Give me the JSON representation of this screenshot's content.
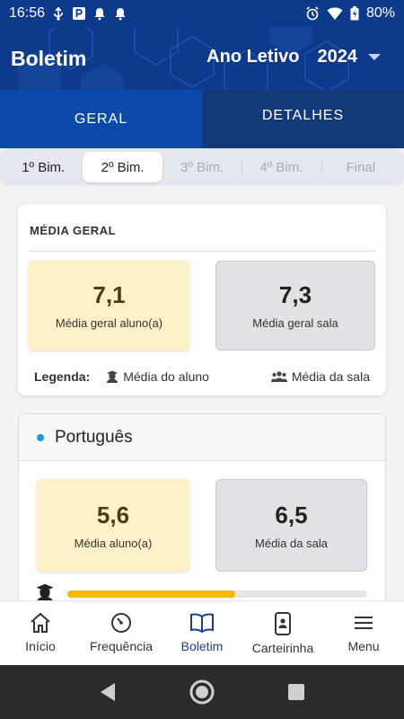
{
  "status_bar": {
    "time": "16:56",
    "battery": "80%"
  },
  "header": {
    "title": "Boletim",
    "year_label": "Ano Letivo",
    "year_value": "2024"
  },
  "tabs": [
    {
      "label": "GERAL",
      "active": true
    },
    {
      "label": "DETALHES",
      "active": false
    }
  ],
  "bimesters": [
    {
      "label": "1º Bim.",
      "state": "enabled"
    },
    {
      "label": "2º Bim.",
      "state": "selected"
    },
    {
      "label": "3º Bim.",
      "state": "disabled"
    },
    {
      "label": "4º Bim.",
      "state": "disabled"
    },
    {
      "label": "Final",
      "state": "disabled"
    }
  ],
  "overall": {
    "title": "MÉDIA GERAL",
    "student_value": "7,1",
    "student_label": "Média geral aluno(a)",
    "room_value": "7,3",
    "room_label": "Média geral sala",
    "legend_label": "Legenda:",
    "legend_student": "Média do aluno",
    "legend_room": "Média da sala"
  },
  "subject": {
    "name": "Português",
    "student_value": "5,6",
    "student_label": "Média aluno(a)",
    "room_value": "6,5",
    "room_label": "Média da sala",
    "progress_fraction": 0.56
  },
  "bottom_nav": [
    {
      "label": "Início",
      "icon": "home-icon"
    },
    {
      "label": "Frequência",
      "icon": "speedometer-icon"
    },
    {
      "label": "Boletim",
      "icon": "book-icon",
      "active": true
    },
    {
      "label": "Carteirinha",
      "icon": "id-card-phone-icon"
    },
    {
      "label": "Menu",
      "icon": "hamburger-menu-icon"
    }
  ],
  "colors": {
    "header_blue": "#0e3a8c",
    "active_tab": "#0b4aa8",
    "student_card": "#fdf1c9",
    "room_card": "#e1e2e5",
    "progress": "#f6b800",
    "subject_dot": "#1b9ad6"
  }
}
